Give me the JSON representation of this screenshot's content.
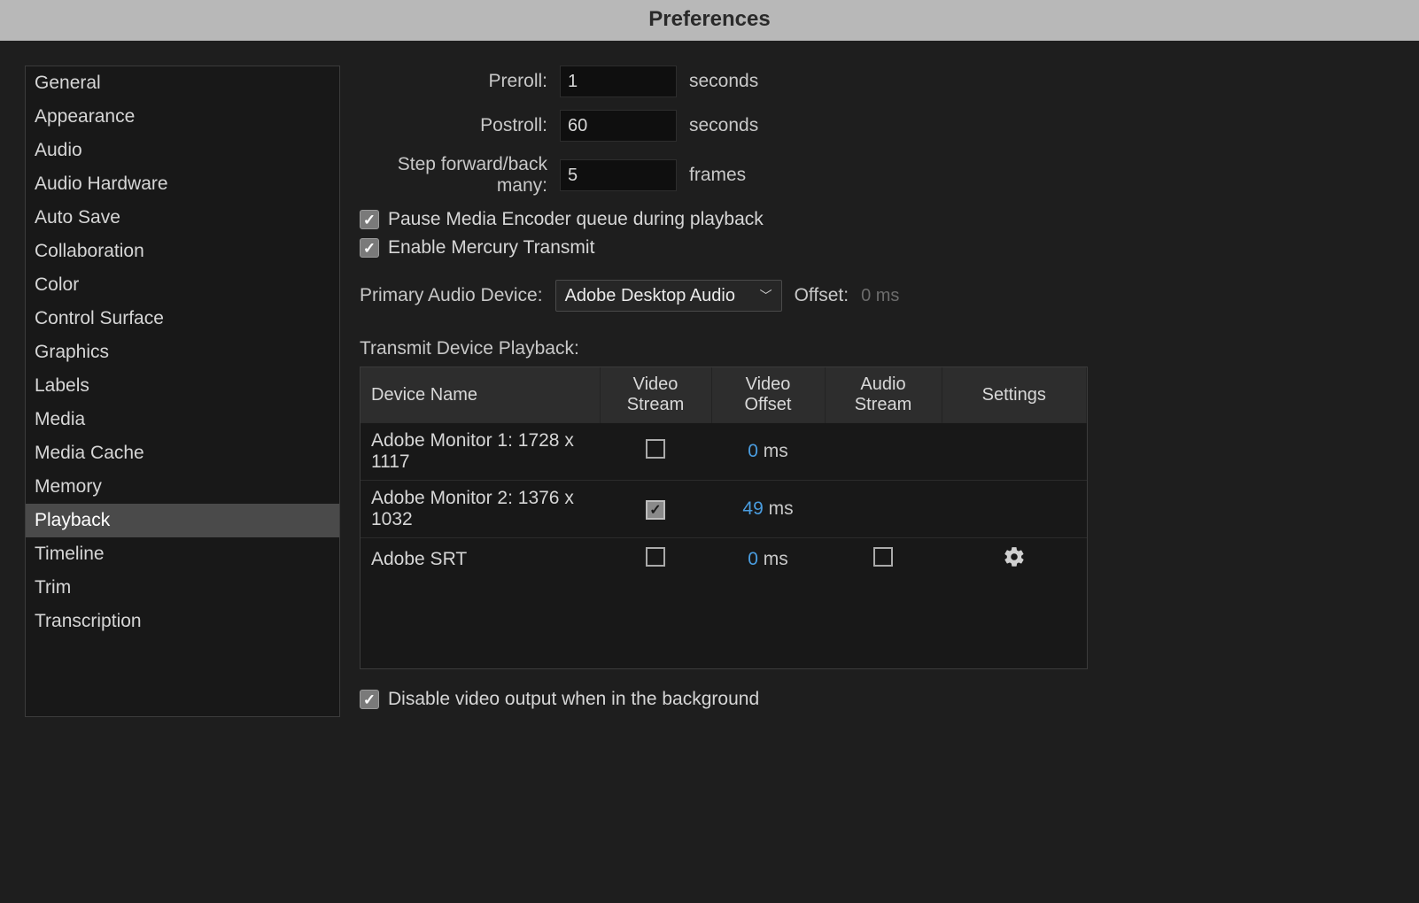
{
  "title": "Preferences",
  "sidebar": {
    "items": [
      {
        "label": "General"
      },
      {
        "label": "Appearance"
      },
      {
        "label": "Audio"
      },
      {
        "label": "Audio Hardware"
      },
      {
        "label": "Auto Save"
      },
      {
        "label": "Collaboration"
      },
      {
        "label": "Color"
      },
      {
        "label": "Control Surface"
      },
      {
        "label": "Graphics"
      },
      {
        "label": "Labels"
      },
      {
        "label": "Media"
      },
      {
        "label": "Media Cache"
      },
      {
        "label": "Memory"
      },
      {
        "label": "Playback"
      },
      {
        "label": "Timeline"
      },
      {
        "label": "Trim"
      },
      {
        "label": "Transcription"
      }
    ],
    "selected_index": 13
  },
  "fields": {
    "preroll": {
      "label": "Preroll:",
      "value": "1",
      "unit": "seconds"
    },
    "postroll": {
      "label": "Postroll:",
      "value": "60",
      "unit": "seconds"
    },
    "step": {
      "label": "Step forward/back many:",
      "value": "5",
      "unit": "frames"
    }
  },
  "checks": {
    "pause_encoder": {
      "label": "Pause Media Encoder queue during playback",
      "checked": true
    },
    "mercury": {
      "label": "Enable Mercury Transmit",
      "checked": true
    },
    "disable_bg": {
      "label": "Disable video output when in the background",
      "checked": true
    }
  },
  "audio": {
    "primary_label": "Primary Audio Device:",
    "primary_value": "Adobe Desktop Audio",
    "offset_label": "Offset:",
    "offset_value": "0 ms"
  },
  "transmit": {
    "heading": "Transmit Device Playback:",
    "columns": {
      "name": "Device Name",
      "vs": "Video Stream",
      "vo": "Video Offset",
      "as": "Audio Stream",
      "set": "Settings"
    },
    "rows": [
      {
        "name": "Adobe Monitor 1: 1728 x 1117",
        "vs_checked": false,
        "vo_num": "0",
        "vo_unit": " ms",
        "has_as": false,
        "as_checked": false,
        "has_settings": false
      },
      {
        "name": "Adobe Monitor 2: 1376 x 1032",
        "vs_checked": true,
        "vo_num": "49",
        "vo_unit": " ms",
        "has_as": false,
        "as_checked": false,
        "has_settings": false
      },
      {
        "name": "Adobe SRT",
        "vs_checked": false,
        "vo_num": "0",
        "vo_unit": " ms",
        "has_as": true,
        "as_checked": false,
        "has_settings": true
      }
    ]
  }
}
